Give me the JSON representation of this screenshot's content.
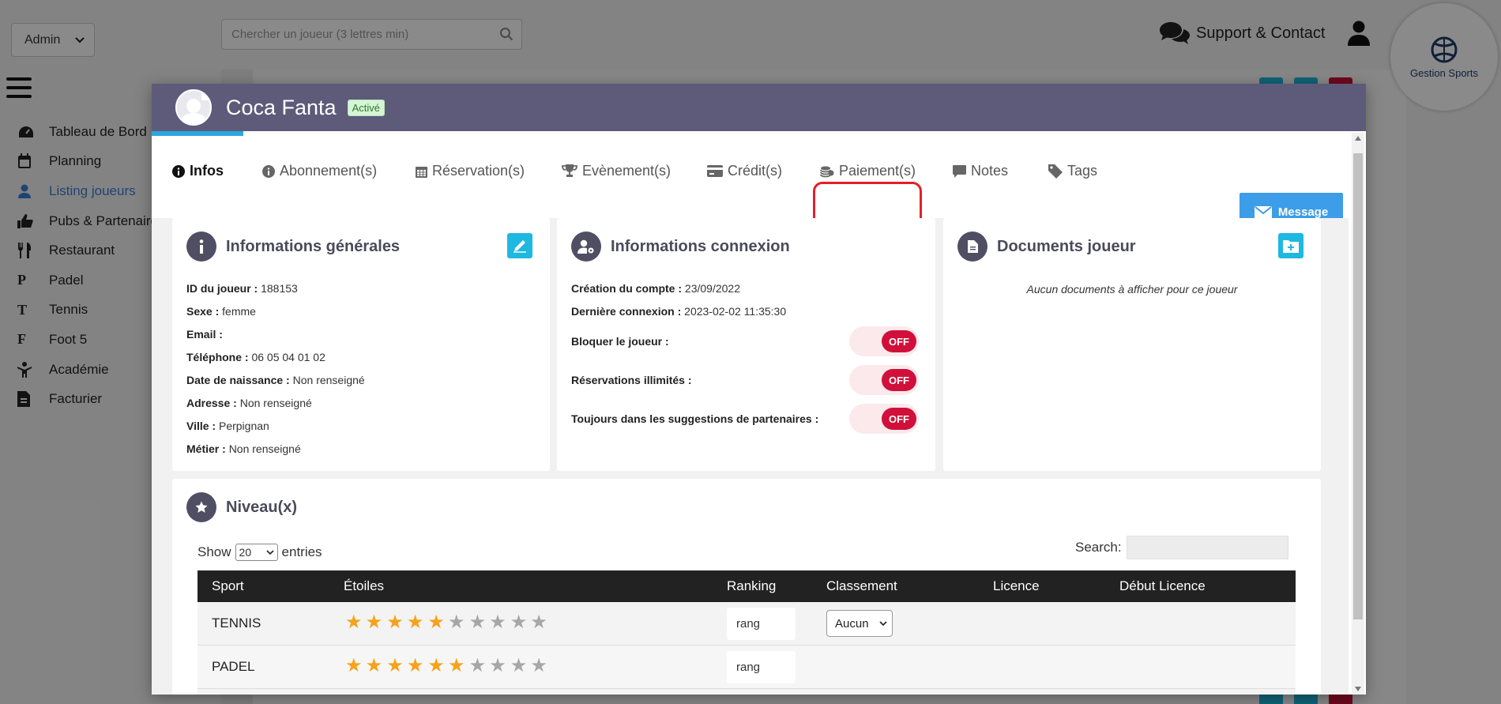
{
  "topbar": {
    "role_select": "Admin",
    "search_placeholder": "Chercher un joueur (3 lettres min)",
    "support_label": "Support & Contact",
    "logo_text": "Gestion Sports"
  },
  "sidebar": {
    "items": [
      {
        "label": "Tableau de Bord",
        "icon": "dashboard-icon"
      },
      {
        "label": "Planning",
        "icon": "calendar-icon"
      },
      {
        "label": "Listing joueurs",
        "icon": "user-icon"
      },
      {
        "label": "Pubs & Partenaires",
        "icon": "thumbs-up-icon"
      },
      {
        "label": "Restaurant",
        "icon": "utensils-icon"
      },
      {
        "label": "Padel",
        "icon": "letter-p-icon",
        "glyph": "P"
      },
      {
        "label": "Tennis",
        "icon": "letter-t-icon",
        "glyph": "T"
      },
      {
        "label": "Foot 5",
        "icon": "letter-f-icon",
        "glyph": "F"
      },
      {
        "label": "Académie",
        "icon": "academy-icon"
      },
      {
        "label": "Facturier",
        "icon": "invoice-icon"
      }
    ]
  },
  "modal": {
    "player_name": "Coca Fanta",
    "status_badge": "Activé",
    "tabs": [
      {
        "label": "Infos",
        "icon": "info-circle-icon"
      },
      {
        "label": "Abonnement(s)",
        "icon": "info-circle-icon"
      },
      {
        "label": "Réservation(s)",
        "icon": "calendar-icon"
      },
      {
        "label": "Evènement(s)",
        "icon": "trophy-icon"
      },
      {
        "label": "Crédit(s)",
        "icon": "credit-card-icon"
      },
      {
        "label": "Paiement(s)",
        "icon": "coins-icon"
      },
      {
        "label": "Notes",
        "icon": "comment-icon"
      },
      {
        "label": "Tags",
        "icon": "tag-icon"
      }
    ],
    "message_button": "Message",
    "general_info": {
      "title": "Informations générales",
      "rows": [
        {
          "label": "ID du joueur :",
          "value": "188153"
        },
        {
          "label": "Sexe :",
          "value": "femme"
        },
        {
          "label": "Email :",
          "value": ""
        },
        {
          "label": "Téléphone :",
          "value": "06 05 04 01 02"
        },
        {
          "label": "Date de naissance :",
          "value": "Non renseigné"
        },
        {
          "label": "Adresse :",
          "value": "Non renseigné"
        },
        {
          "label": "Ville :",
          "value": "Perpignan"
        },
        {
          "label": "Métier :",
          "value": "Non renseigné"
        }
      ]
    },
    "connection_info": {
      "title": "Informations connexion",
      "rows": [
        {
          "label": "Création du compte :",
          "value": "23/09/2022"
        },
        {
          "label": "Dernière connexion :",
          "value": "2023-02-02 11:35:30"
        }
      ],
      "toggles": [
        {
          "label": "Bloquer le joueur :",
          "state": "OFF"
        },
        {
          "label": "Réservations illimités :",
          "state": "OFF"
        },
        {
          "label": "Toujours dans les suggestions de partenaires :",
          "state": "OFF"
        }
      ]
    },
    "documents": {
      "title": "Documents joueur",
      "empty_text": "Aucun documents à afficher pour ce joueur"
    },
    "levels": {
      "title": "Niveau(x)",
      "show_label": "Show",
      "entries_value": "20",
      "entries_label": "entries",
      "search_label": "Search:",
      "columns": [
        "Sport",
        "Étoiles",
        "Ranking",
        "Classement",
        "Licence",
        "Début Licence"
      ],
      "rows": [
        {
          "sport": "TENNIS",
          "stars": 5,
          "stars_total": 10,
          "ranking_placeholder": "rang",
          "classement": "Aucun"
        },
        {
          "sport": "PADEL",
          "stars": 6,
          "stars_total": 10,
          "ranking_placeholder": "rang",
          "classement": ""
        }
      ]
    }
  },
  "colors": {
    "header_bg": "#5e5a7a",
    "accent": "#2aa7df",
    "message_btn": "#3d9de8",
    "toggle_off": "#d0103a",
    "star_on": "#f6a21a",
    "highlight_box": "#e3202a"
  }
}
